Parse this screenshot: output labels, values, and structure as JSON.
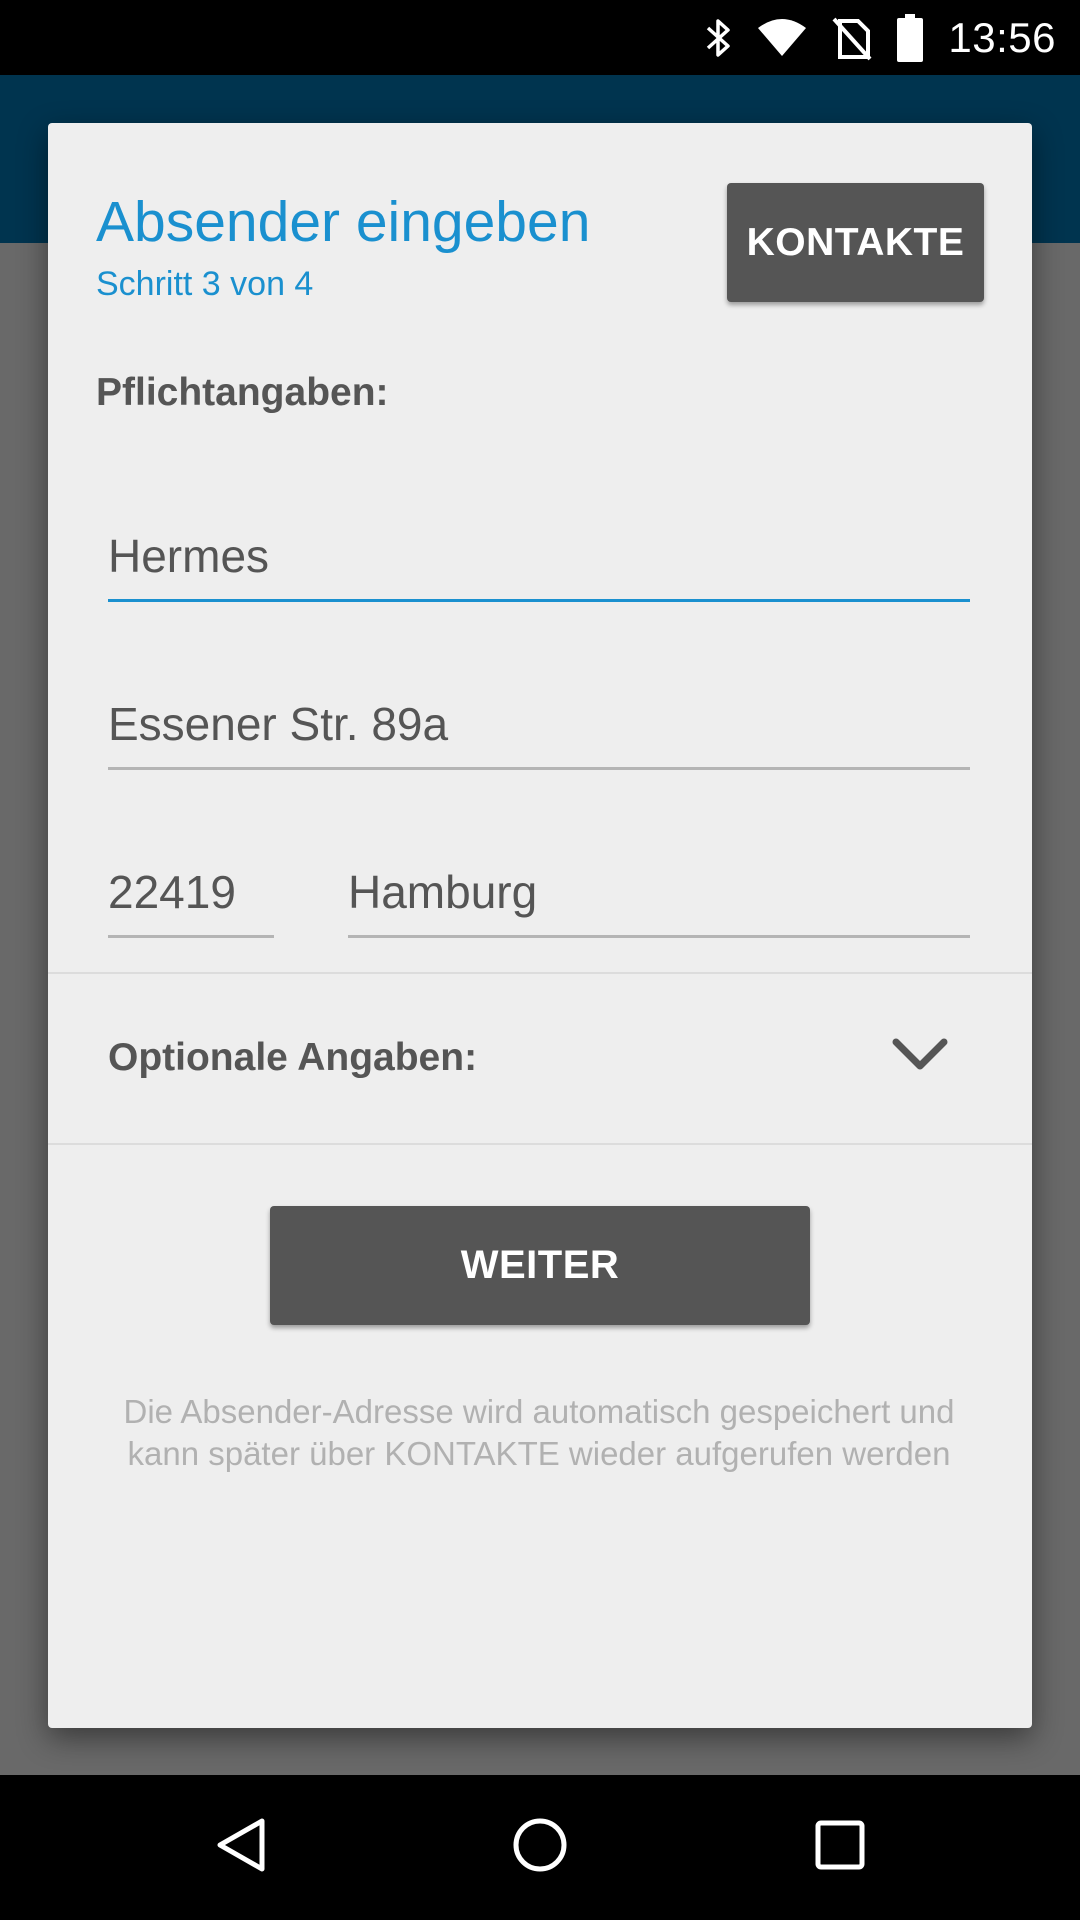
{
  "status_bar": {
    "time": "13:56",
    "icons": [
      "bluetooth-icon",
      "wifi-icon",
      "no-sim-icon",
      "battery-icon"
    ]
  },
  "dialog": {
    "title": "Absender eingeben",
    "subtitle": "Schritt 3 von 4",
    "contacts_button": "KONTAKTE",
    "required_label": "Pflichtangaben:",
    "fields": {
      "name": "Hermes",
      "street": "Essener Str. 89a",
      "zip": "22419",
      "city": "Hamburg"
    },
    "optional_label": "Optionale Angaben:",
    "next_button": "WEITER",
    "hint": "Die Absender-Adresse wird automatisch gespeichert und kann später über KONTAKTE wieder aufgerufen werden"
  },
  "colors": {
    "accent": "#1a90cf",
    "toolbar": "#00344f",
    "button": "#555555",
    "dialog_bg": "#eeeeee"
  },
  "nav_bar": {
    "icons": [
      "back-icon",
      "home-icon",
      "recents-icon"
    ]
  }
}
